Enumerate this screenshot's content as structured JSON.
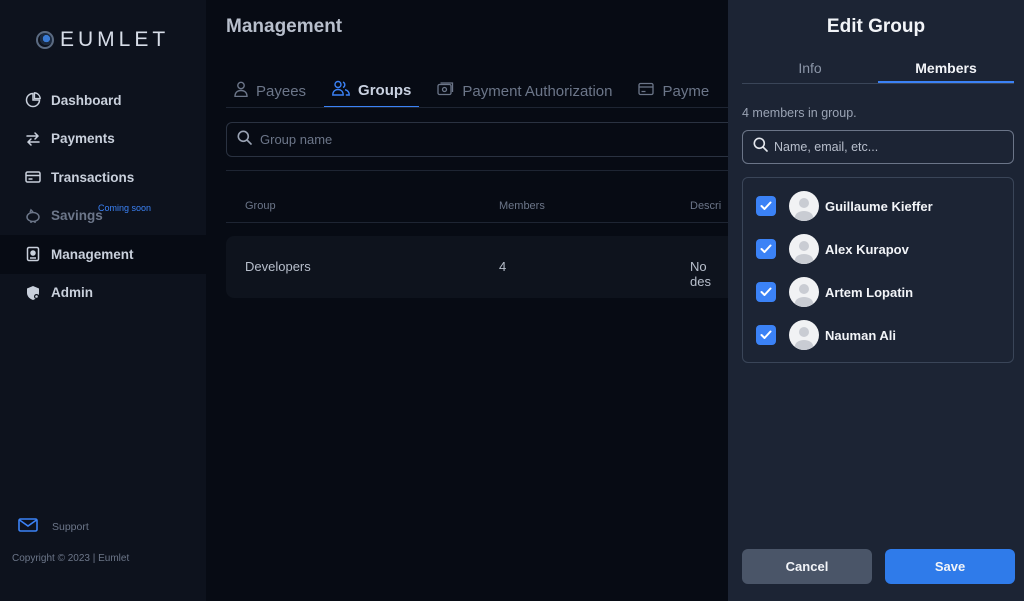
{
  "app": {
    "name": "EUMLET"
  },
  "sidebar": {
    "items": [
      {
        "label": "Dashboard",
        "icon": "pie-chart-icon",
        "active": false
      },
      {
        "label": "Payments",
        "icon": "arrows-swap-icon",
        "active": false
      },
      {
        "label": "Transactions",
        "icon": "card-icon",
        "active": false
      },
      {
        "label": "Savings",
        "icon": "piggy-bank-icon",
        "active": false,
        "badge": "Coming soon"
      },
      {
        "label": "Management",
        "icon": "id-badge-icon",
        "active": true
      },
      {
        "label": "Admin",
        "icon": "shield-icon",
        "active": false
      }
    ],
    "support_label": "Support",
    "copyright": "Copyright © 2023 | Eumlet"
  },
  "main": {
    "title": "Management",
    "tabs": [
      {
        "label": "Payees",
        "icon": "person-icon",
        "active": false
      },
      {
        "label": "Groups",
        "icon": "people-icon",
        "active": true
      },
      {
        "label": "Payment Authorization",
        "icon": "payment-auth-icon",
        "active": false
      },
      {
        "label": "Payme",
        "icon": "card-icon",
        "active": false
      }
    ],
    "search": {
      "placeholder": "Group name",
      "value": ""
    },
    "table": {
      "columns": [
        "Group",
        "Members",
        "Descri"
      ],
      "rows": [
        {
          "group": "Developers",
          "members": "4",
          "description": "No des"
        }
      ]
    }
  },
  "panel": {
    "title": "Edit Group",
    "tabs": [
      {
        "label": "Info",
        "active": false
      },
      {
        "label": "Members",
        "active": true
      }
    ],
    "member_count": "4 members in group.",
    "search": {
      "placeholder": "Name, email, etc...",
      "value": ""
    },
    "members": [
      {
        "name": "Guillaume Kieffer",
        "checked": true
      },
      {
        "name": "Alex Kurapov",
        "checked": true
      },
      {
        "name": "Artem Lopatin",
        "checked": true
      },
      {
        "name": "Nauman Ali",
        "checked": true
      }
    ],
    "cancel_label": "Cancel",
    "save_label": "Save"
  },
  "colors": {
    "accent": "#3b82f6",
    "background": "#070b14",
    "sidebar": "#0d121d",
    "panel": "#1c2434"
  }
}
